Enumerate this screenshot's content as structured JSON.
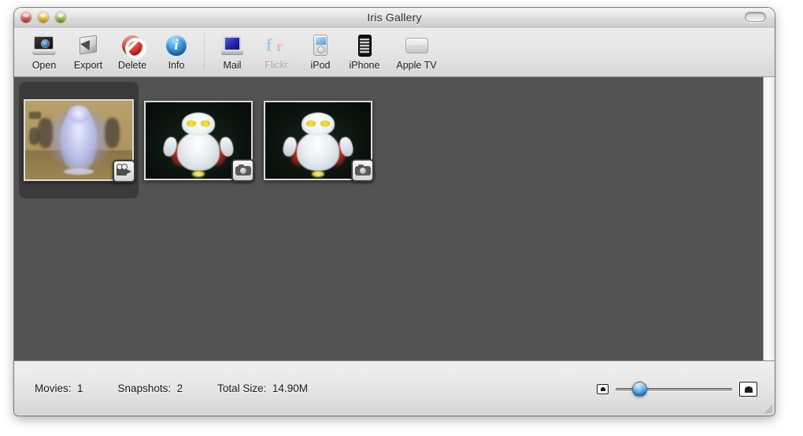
{
  "window": {
    "title": "Iris Gallery",
    "controls": {
      "close": "close-button",
      "minimize": "minimize-button",
      "zoom": "zoom-button"
    },
    "toolbar_toggle": "toolbar-toggle-button"
  },
  "toolbar": {
    "items": [
      {
        "id": "open",
        "label": "Open",
        "icon": "display-open-icon",
        "enabled": true
      },
      {
        "id": "export",
        "label": "Export",
        "icon": "export-arrow-icon",
        "enabled": true
      },
      {
        "id": "delete",
        "label": "Delete",
        "icon": "delete-prohibit-icon",
        "enabled": true
      },
      {
        "id": "info",
        "label": "Info",
        "icon": "info-circle-icon",
        "enabled": true
      },
      {
        "id": "mail",
        "label": "Mail",
        "icon": "mail-stamp-icon",
        "enabled": true
      },
      {
        "id": "flickr",
        "label": "Flickr",
        "icon": "flickr-logo-icon",
        "enabled": false
      },
      {
        "id": "ipod",
        "label": "iPod",
        "icon": "ipod-icon",
        "enabled": true
      },
      {
        "id": "iphone",
        "label": "iPhone",
        "icon": "iphone-icon",
        "enabled": true
      },
      {
        "id": "appletv",
        "label": "Apple TV",
        "icon": "apple-tv-icon",
        "enabled": true
      }
    ]
  },
  "gallery": {
    "items": [
      {
        "kind": "movie",
        "badge": "movie-camera-badge-icon",
        "selected": true
      },
      {
        "kind": "snapshot",
        "badge": "still-camera-badge-icon",
        "selected": false
      },
      {
        "kind": "snapshot",
        "badge": "still-camera-badge-icon",
        "selected": false
      }
    ]
  },
  "status": {
    "movies_label": "Movies:",
    "movies_value": "1",
    "snapshots_label": "Snapshots:",
    "snapshots_value": "2",
    "total_size_label": "Total Size:",
    "total_size_value": "14.90M",
    "slider": {
      "small_icon": "small-thumbnail-icon",
      "large_icon": "large-thumbnail-icon",
      "value_percent": 16
    }
  },
  "colors": {
    "content_background": "#535353",
    "selection": "#3b3b3b",
    "toolbar": "#e6e6e6",
    "slider_knob": "#2f8ede"
  }
}
